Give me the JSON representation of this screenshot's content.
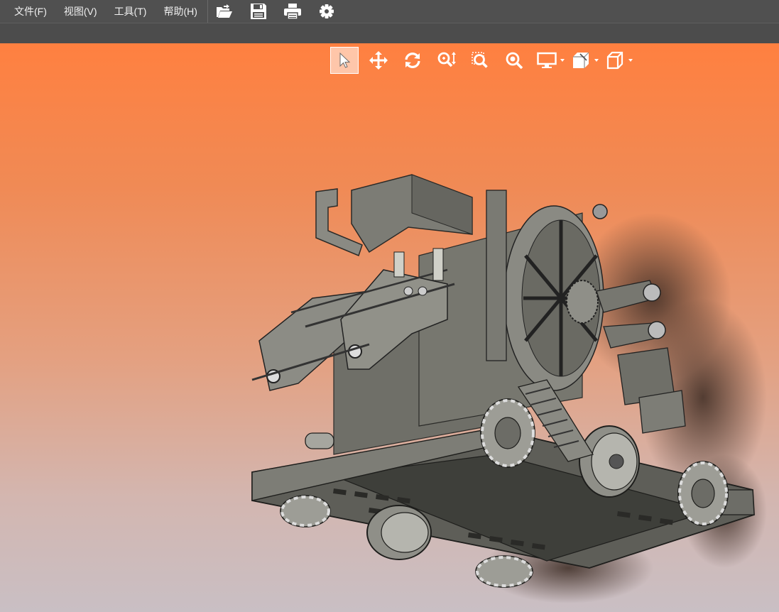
{
  "menubar": {
    "items": [
      {
        "label": "文件(F)",
        "name": "menu-file"
      },
      {
        "label": "视图(V)",
        "name": "menu-view"
      },
      {
        "label": "工具(T)",
        "name": "menu-tools"
      },
      {
        "label": "帮助(H)",
        "name": "menu-help"
      }
    ],
    "tools": [
      "open-folder-icon",
      "save-icon",
      "print-icon",
      "settings-gear-icon"
    ]
  },
  "view_toolbar": {
    "tools": [
      "select-pointer-icon",
      "pan-icon",
      "rotate-icon",
      "zoom-icon",
      "zoom-window-icon",
      "zoom-fit-icon",
      "display-mode-icon",
      "section-view-icon",
      "standard-views-cube-icon"
    ],
    "active_tool": "select-pointer-icon"
  },
  "colors": {
    "menubar_bg": "#505050",
    "viewport_top": "#ff8040",
    "viewport_bottom": "#c9bfc4",
    "model_gray": "#7a7a72"
  }
}
